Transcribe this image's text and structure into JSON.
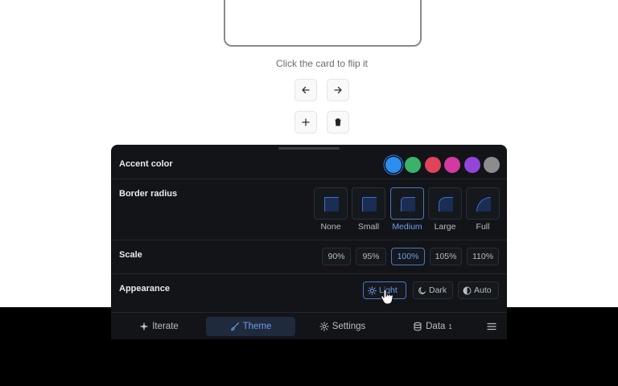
{
  "hint": "Click the card to flip it",
  "nav": {
    "prev_icon": "arrow-left-icon",
    "next_icon": "arrow-right-icon",
    "add_icon": "plus-icon",
    "delete_icon": "trash-icon"
  },
  "panel": {
    "accent": {
      "label": "Accent color",
      "swatches": [
        "#2b8ef0",
        "#3ab26a",
        "#e0435a",
        "#d23aa2",
        "#9444d8",
        "#8c8c8c"
      ],
      "selected_index": 0
    },
    "radius": {
      "label": "Border radius",
      "options": [
        "None",
        "Small",
        "Medium",
        "Large",
        "Full"
      ],
      "selected": "Medium"
    },
    "scale": {
      "label": "Scale",
      "options": [
        "90%",
        "95%",
        "100%",
        "105%",
        "110%"
      ],
      "selected": "100%"
    },
    "appearance": {
      "label": "Appearance",
      "options": [
        "Light",
        "Dark",
        "Auto"
      ],
      "selected": "Light"
    },
    "tabs": [
      {
        "label": "Iterate",
        "icon": "sparkle-icon"
      },
      {
        "label": "Theme",
        "icon": "brush-icon"
      },
      {
        "label": "Settings",
        "icon": "gear-icon"
      },
      {
        "label": "Data",
        "icon": "database-icon",
        "badge": "1"
      }
    ],
    "active_tab": "Theme",
    "menu_icon": "hamburger-menu-icon"
  }
}
